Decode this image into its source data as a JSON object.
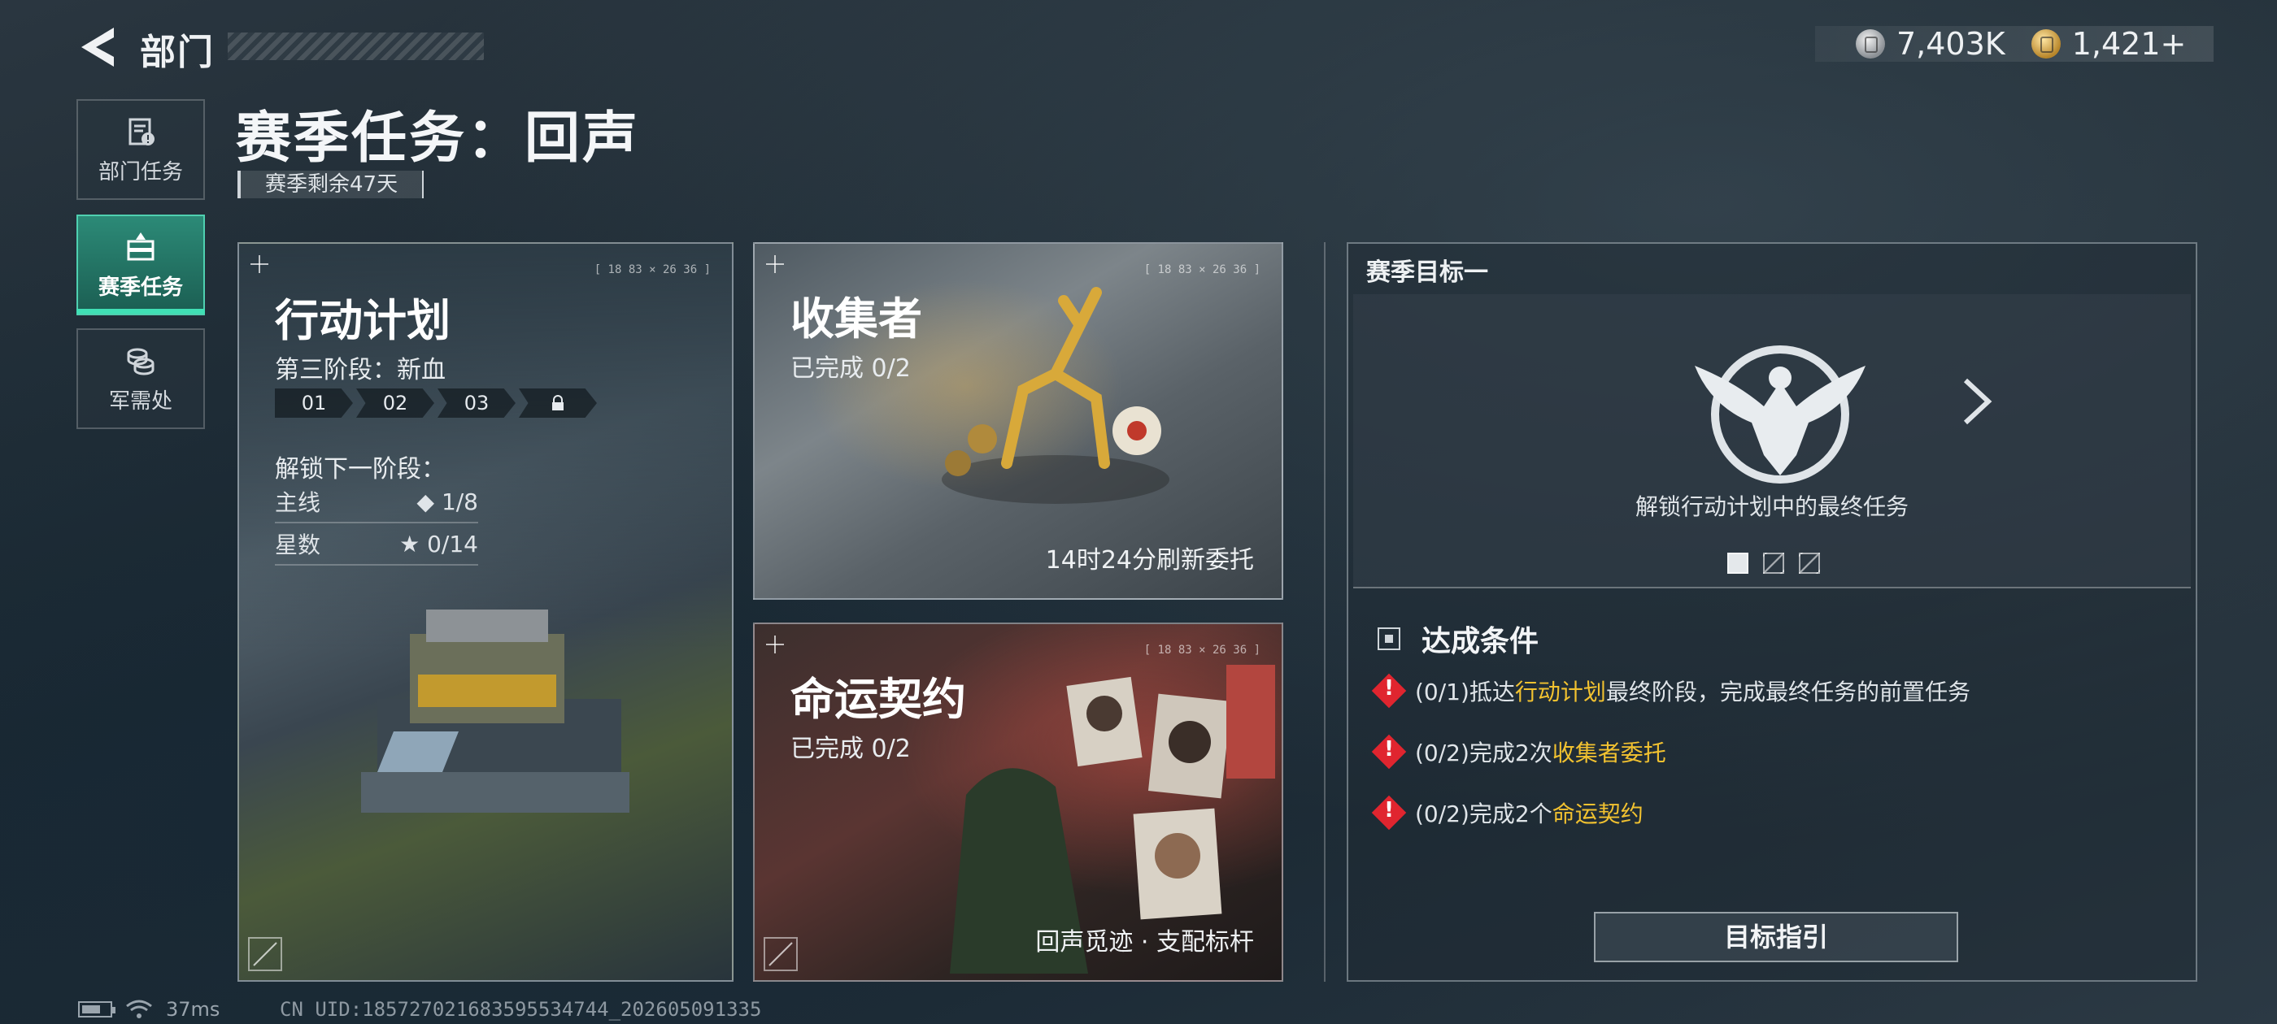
{
  "header": {
    "title": "部门"
  },
  "currency": [
    {
      "icon": "silver-coin-icon",
      "value": "7,403K"
    },
    {
      "icon": "gold-coin-icon",
      "value": "1,421+"
    }
  ],
  "nav": {
    "items": [
      {
        "label": "部门任务",
        "icon": "department-mission-icon"
      },
      {
        "label": "赛季任务",
        "icon": "season-mission-icon",
        "active": true
      },
      {
        "label": "军需处",
        "icon": "supply-coins-icon"
      }
    ]
  },
  "page": {
    "title": "赛季任务：回声",
    "season_remaining": "赛季剩余47天"
  },
  "operation_plan": {
    "title": "行动计划",
    "stage": "第三阶段：新血",
    "stages": [
      "01",
      "02",
      "03"
    ],
    "unlock_label": "解锁下一阶段：",
    "main_line_label": "主线",
    "main_line_value": "1/8",
    "stars_label": "星数",
    "stars_value": "0/14",
    "corner_code": "[ 18 83 × 26 36 ]"
  },
  "collector": {
    "title": "收集者",
    "progress": "已完成 0/2",
    "footer": "14时24分刷新委托",
    "corner_code": "[ 18 83 × 26 36 ]"
  },
  "fate_contract": {
    "title": "命运契约",
    "progress": "已完成 0/2",
    "footer": "回声觅迹 · 支配标杆",
    "corner_code": "[ 18 83 × 26 36 ]"
  },
  "season_goal": {
    "title": "赛季目标一",
    "description": "解锁行动计划中的最终任务",
    "page_count": 3,
    "current_page": 1,
    "conditions_title": "达成条件",
    "conditions": [
      {
        "prefix": "(0/1)抵达",
        "highlight": "行动计划",
        "suffix": "最终阶段，完成最终任务的前置任务"
      },
      {
        "prefix": "(0/2)完成2次",
        "highlight": "收集者委托",
        "suffix": ""
      },
      {
        "prefix": "(0/2)完成2个",
        "highlight": "命运契约",
        "suffix": ""
      }
    ],
    "guide_button": "目标指引"
  },
  "status_bar": {
    "ping": "37ms",
    "uid": "CN UID:1857270216835955347​44_202605091335"
  },
  "colors": {
    "accent": "#40e0b5",
    "highlight": "#f2c230",
    "warning": "#e0252f"
  }
}
